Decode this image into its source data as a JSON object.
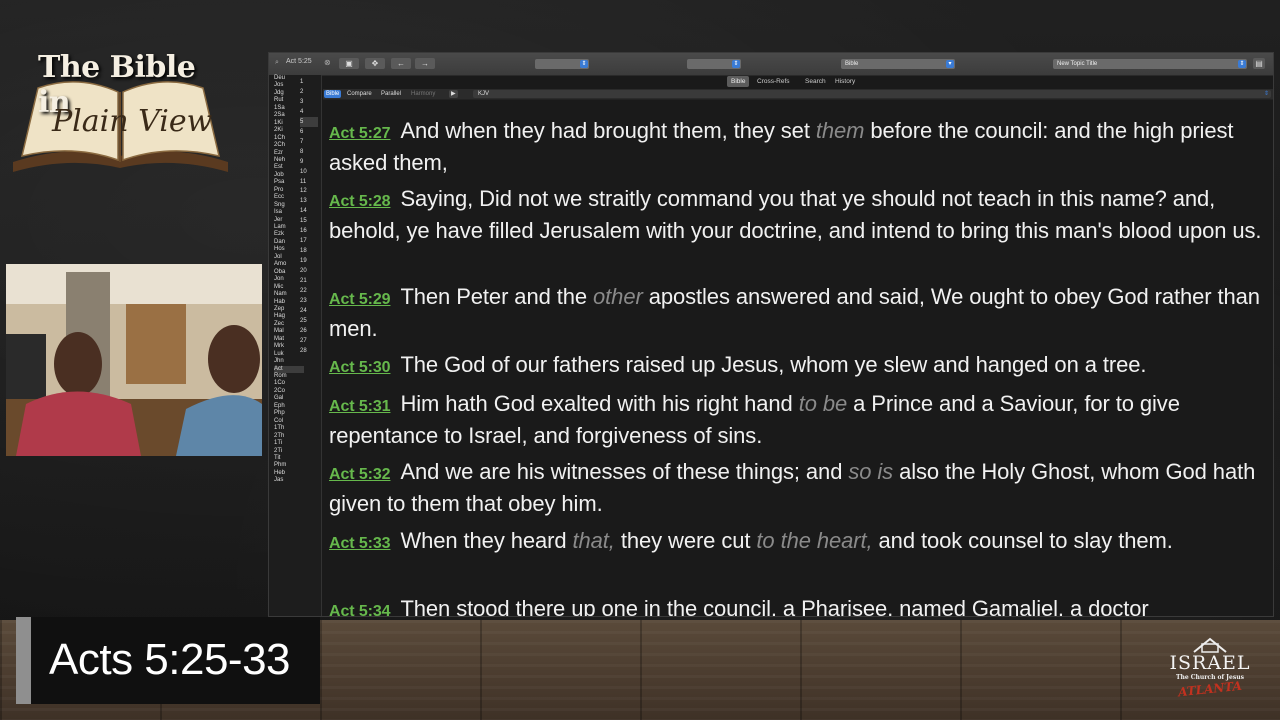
{
  "logo": {
    "line1": "The Bible in",
    "line2": "Plain View"
  },
  "toolbar": {
    "ref": "Act 5:25",
    "select1": "",
    "select2": "",
    "select3": "Bible",
    "select4": "New Topic Title"
  },
  "subtabs": [
    "Bible",
    "Cross-Refs",
    "Search",
    "History"
  ],
  "main_tabs": {
    "bible": "Bible",
    "compare": "Compare",
    "parallel": "Parallel",
    "harmony": "Harmony",
    "version": "KJV"
  },
  "books": [
    "Deu",
    "Jos",
    "Jdg",
    "Rut",
    "1Sa",
    "2Sa",
    "1Ki",
    "2Ki",
    "1Ch",
    "2Ch",
    "Ezr",
    "Neh",
    "Est",
    "Job",
    "Psa",
    "Pro",
    "Ecc",
    "Sng",
    "Isa",
    "Jer",
    "Lam",
    "Ezk",
    "Dan",
    "Hos",
    "Jol",
    "Amo",
    "Oba",
    "Jon",
    "Mic",
    "Nam",
    "Hab",
    "Zep",
    "Hag",
    "Zec",
    "Mal",
    "Mat",
    "Mrk",
    "Luk",
    "Jhn",
    "Act",
    "Rom",
    "1Co",
    "2Co",
    "Gal",
    "Eph",
    "Php",
    "Col",
    "1Th",
    "2Th",
    "1Ti",
    "2Ti",
    "Tit",
    "Phm",
    "Heb",
    "Jas"
  ],
  "selected_book": "Act",
  "chapters": [
    "1",
    "2",
    "3",
    "4",
    "5",
    "6",
    "7",
    "8",
    "9",
    "10",
    "11",
    "12",
    "13",
    "14",
    "15",
    "16",
    "17",
    "18",
    "19",
    "20",
    "21",
    "22",
    "23",
    "24",
    "25",
    "26",
    "27",
    "28"
  ],
  "selected_chapter": "5",
  "verses": [
    {
      "ref": "Act 5:27",
      "parts": [
        {
          "t": "And when they had brought them, they set "
        },
        {
          "t": "them",
          "i": true
        },
        {
          "t": " before the council: and the high priest asked them,"
        }
      ]
    },
    {
      "ref": "Act 5:28",
      "parts": [
        {
          "t": "Saying, Did not we straitly command you that ye should not teach in this name? and, behold, ye have filled Jerusalem with your doctrine, and intend to bring this man's blood upon us."
        }
      ]
    },
    {
      "ref": "Act 5:29",
      "parts": [
        {
          "t": "Then Peter and the "
        },
        {
          "t": "other",
          "i": true
        },
        {
          "t": " apostles answered and said, We ought to obey God rather than men."
        }
      ]
    },
    {
      "ref": "Act 5:30",
      "parts": [
        {
          "t": "The God of our fathers raised up Jesus, whom ye slew and hanged on a tree."
        }
      ]
    },
    {
      "ref": "Act 5:31",
      "parts": [
        {
          "t": "Him hath God exalted with his right hand "
        },
        {
          "t": "to be",
          "i": true
        },
        {
          "t": " a Prince and a Saviour, for to give repentance to Israel, and forgiveness of sins."
        }
      ]
    },
    {
      "ref": "Act 5:32",
      "parts": [
        {
          "t": "And we are his witnesses of these things; and "
        },
        {
          "t": "so is",
          "i": true
        },
        {
          "t": " also the Holy Ghost, whom God hath given to them that obey him."
        }
      ]
    },
    {
      "ref": "Act 5:33",
      "parts": [
        {
          "t": "When they heard "
        },
        {
          "t": "that,",
          "i": true
        },
        {
          "t": " they were cut "
        },
        {
          "t": "to the heart,",
          "i": true
        },
        {
          "t": " and took counsel to slay them."
        }
      ]
    },
    {
      "ref": "Act 5:34",
      "parts": [
        {
          "t": "Then stood there up one in the council, a Pharisee, named Gamaliel, a doctor"
        }
      ]
    }
  ],
  "lower_third": {
    "title": "Acts 5:25-33"
  },
  "church": {
    "name": "ISRAEL",
    "sub": "The Church of Jesus",
    "city": "ATLANTA"
  },
  "colors": {
    "verse_ref": "#66b84c",
    "accent": "#3a7bd5",
    "italic_text": "#8a8a8a"
  }
}
